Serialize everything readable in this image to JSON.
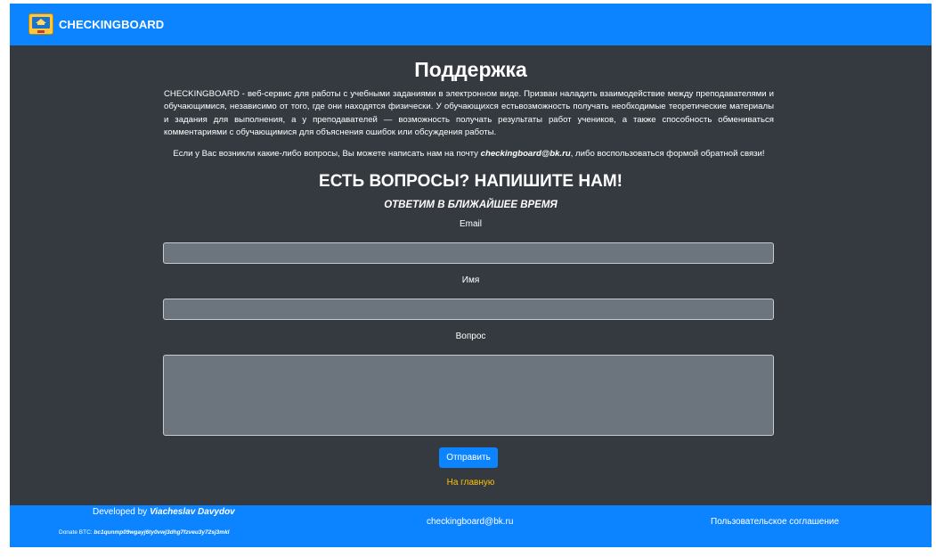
{
  "navbar": {
    "brand": "CHECKINGBOARD",
    "logo_icon": "monitor-graduation-cap-icon"
  },
  "main": {
    "title": "Поддержка",
    "description": "CHECKINGBOARD - веб-сервис для работы с учебными заданиями в электронном виде. Призван наладить взаимодействие между преподавателями и обучающимися, независимо от того, где они находятся физически. У обучающихся естьвозможность получать необходимые теоретические материалы и задания для выполнения, а у преподавателей — возможность получать результаты работ учеников, а также способность обмениваться комментариями с обучающимися для объяснения ошибок или обсуждения работы.",
    "contact_before": "Если у Вас возникли какие-либо вопросы, Вы можете написать нам на почту ",
    "contact_email": "checkingboard@bk.ru",
    "contact_after": ", либо воспользоваться формой обратной связи!",
    "form_heading": "ЕСТЬ ВОПРОСЫ? НАПИШИТЕ НАМ!",
    "form_subheading": "ОТВЕТИМ В БЛИЖАЙШЕЕ ВРЕМЯ"
  },
  "form": {
    "email_label": "Email",
    "email_value": "",
    "name_label": "Имя",
    "name_value": "",
    "question_label": "Вопрос",
    "question_value": "",
    "submit_label": "Отправить",
    "home_link": "На главную"
  },
  "footer": {
    "developed_by": "Developed by ",
    "developer_name": "Viacheslav Davydov",
    "donate_label": "Donate BTC: ",
    "donate_address": "bc1qunmp09wgayj6ty0vwj3dhg7fzveu3y72sj3mkl",
    "email": "checkingboard@bk.ru",
    "terms": "Пользовательское соглашение"
  },
  "colors": {
    "primary": "#0d84ff",
    "background": "#343a40",
    "field": "#6c757d",
    "link": "#ffc107"
  }
}
